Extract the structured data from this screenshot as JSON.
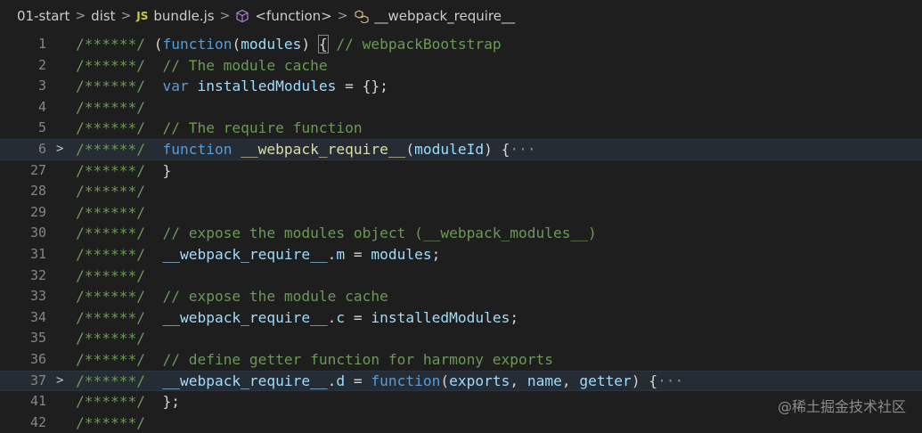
{
  "breadcrumb": {
    "folder1": "01-start",
    "folder2": "dist",
    "file_badge": "JS",
    "file": "bundle.js",
    "symbol1": "<function>",
    "symbol2": "__webpack_require__",
    "separator": ">"
  },
  "lines": [
    {
      "n": "1",
      "fold": false,
      "tokens": [
        [
          "/******/ ",
          "cmt"
        ],
        [
          "(",
          "txt"
        ],
        [
          "function",
          "kw"
        ],
        [
          "(",
          "txt"
        ],
        [
          "modules",
          "var"
        ],
        [
          ") ",
          "txt"
        ],
        [
          "{",
          "brace"
        ],
        [
          " // webpackBootstrap",
          "cmt"
        ]
      ]
    },
    {
      "n": "2",
      "fold": false,
      "tokens": [
        [
          "/******/ ",
          "cmt"
        ],
        [
          " // The module cache",
          "cmt"
        ]
      ]
    },
    {
      "n": "3",
      "fold": false,
      "tokens": [
        [
          "/******/ ",
          "cmt"
        ],
        [
          " ",
          "txt"
        ],
        [
          "var",
          "kw"
        ],
        [
          " ",
          "txt"
        ],
        [
          "installedModules",
          "var"
        ],
        [
          " = {};",
          "txt"
        ]
      ]
    },
    {
      "n": "4",
      "fold": false,
      "tokens": [
        [
          "/******/",
          "cmt"
        ]
      ]
    },
    {
      "n": "5",
      "fold": false,
      "tokens": [
        [
          "/******/ ",
          "cmt"
        ],
        [
          " // The require function",
          "cmt"
        ]
      ]
    },
    {
      "n": "6",
      "fold": true,
      "hl": true,
      "tokens": [
        [
          "/******/ ",
          "cmt"
        ],
        [
          " ",
          "txt"
        ],
        [
          "function",
          "kw"
        ],
        [
          " ",
          "txt"
        ],
        [
          "__webpack_require__",
          "fn"
        ],
        [
          "(",
          "txt"
        ],
        [
          "moduleId",
          "var"
        ],
        [
          ") {",
          "txt"
        ],
        [
          "···",
          "ell"
        ]
      ]
    },
    {
      "n": "27",
      "fold": false,
      "tokens": [
        [
          "/******/ ",
          "cmt"
        ],
        [
          " }",
          "txt"
        ]
      ]
    },
    {
      "n": "28",
      "fold": false,
      "tokens": [
        [
          "/******/",
          "cmt"
        ]
      ]
    },
    {
      "n": "29",
      "fold": false,
      "tokens": [
        [
          "/******/",
          "cmt"
        ]
      ]
    },
    {
      "n": "30",
      "fold": false,
      "tokens": [
        [
          "/******/ ",
          "cmt"
        ],
        [
          " // expose the modules object (__webpack_modules__)",
          "cmt"
        ]
      ]
    },
    {
      "n": "31",
      "fold": false,
      "tokens": [
        [
          "/******/ ",
          "cmt"
        ],
        [
          " ",
          "txt"
        ],
        [
          "__webpack_require__",
          "var"
        ],
        [
          ".",
          "txt"
        ],
        [
          "m",
          "var"
        ],
        [
          " = ",
          "txt"
        ],
        [
          "modules",
          "var"
        ],
        [
          ";",
          "txt"
        ]
      ]
    },
    {
      "n": "32",
      "fold": false,
      "tokens": [
        [
          "/******/",
          "cmt"
        ]
      ]
    },
    {
      "n": "33",
      "fold": false,
      "tokens": [
        [
          "/******/ ",
          "cmt"
        ],
        [
          " // expose the module cache",
          "cmt"
        ]
      ]
    },
    {
      "n": "34",
      "fold": false,
      "tokens": [
        [
          "/******/ ",
          "cmt"
        ],
        [
          " ",
          "txt"
        ],
        [
          "__webpack_require__",
          "var"
        ],
        [
          ".",
          "txt"
        ],
        [
          "c",
          "var"
        ],
        [
          " = ",
          "txt"
        ],
        [
          "installedModules",
          "var"
        ],
        [
          ";",
          "txt"
        ]
      ]
    },
    {
      "n": "35",
      "fold": false,
      "tokens": [
        [
          "/******/",
          "cmt"
        ]
      ]
    },
    {
      "n": "36",
      "fold": false,
      "tokens": [
        [
          "/******/ ",
          "cmt"
        ],
        [
          " // define getter function for harmony exports",
          "cmt"
        ]
      ]
    },
    {
      "n": "37",
      "fold": true,
      "hl": true,
      "tokens": [
        [
          "/******/ ",
          "cmt"
        ],
        [
          " ",
          "txt"
        ],
        [
          "__webpack_require__",
          "var"
        ],
        [
          ".",
          "txt"
        ],
        [
          "d",
          "var"
        ],
        [
          " = ",
          "txt"
        ],
        [
          "function",
          "kw"
        ],
        [
          "(",
          "txt"
        ],
        [
          "exports",
          "var"
        ],
        [
          ", ",
          "txt"
        ],
        [
          "name",
          "var"
        ],
        [
          ", ",
          "txt"
        ],
        [
          "getter",
          "var"
        ],
        [
          ") {",
          "txt"
        ],
        [
          "···",
          "ell"
        ]
      ]
    },
    {
      "n": "41",
      "fold": false,
      "tokens": [
        [
          "/******/ ",
          "cmt"
        ],
        [
          " };",
          "txt"
        ]
      ]
    },
    {
      "n": "42",
      "fold": false,
      "tokens": [
        [
          "/******/",
          "cmt"
        ]
      ]
    }
  ],
  "watermark": "@稀土掘金技术社区",
  "colors": {
    "bg": "#1e1e1e",
    "comment": "#6a9955",
    "keyword": "#569cd6",
    "variable": "#9cdcfe",
    "function": "#dcdcaa"
  }
}
